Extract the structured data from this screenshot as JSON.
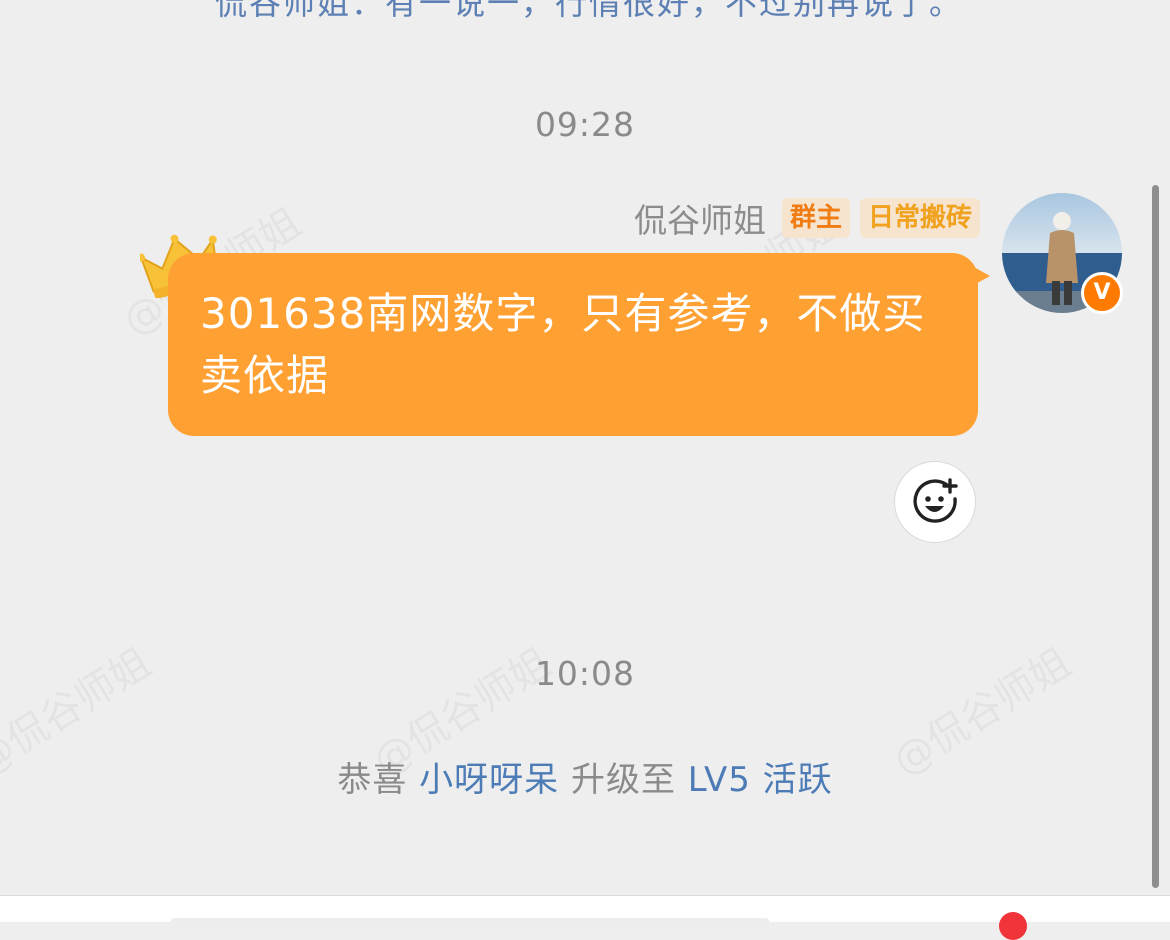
{
  "chat": {
    "top_partial_text": "侃谷师姐：有一说一，行情很好，不过别再说了。",
    "timestamps": [
      "09:28",
      "10:08"
    ],
    "message": {
      "sender_name": "侃谷师姐",
      "badges": [
        "群主",
        "日常搬砖"
      ],
      "text": "301638南网数字，只有参考，不做买卖依据",
      "bubble_color": "#FFA033"
    },
    "system_message": {
      "prefix": "恭喜",
      "user": "小呀呀呆",
      "middle": "升级至",
      "level": "LV5 活跃"
    },
    "watermark_text": "@侃谷师姐"
  },
  "colors": {
    "background": "#EEEEEE",
    "link_blue": "#4C7BB5",
    "owner_badge": "#F07D14",
    "verified_badge": "#FF7A00"
  },
  "icons": {
    "verified": "V",
    "react": "smiley-plus-icon",
    "crown": "crown-icon"
  }
}
